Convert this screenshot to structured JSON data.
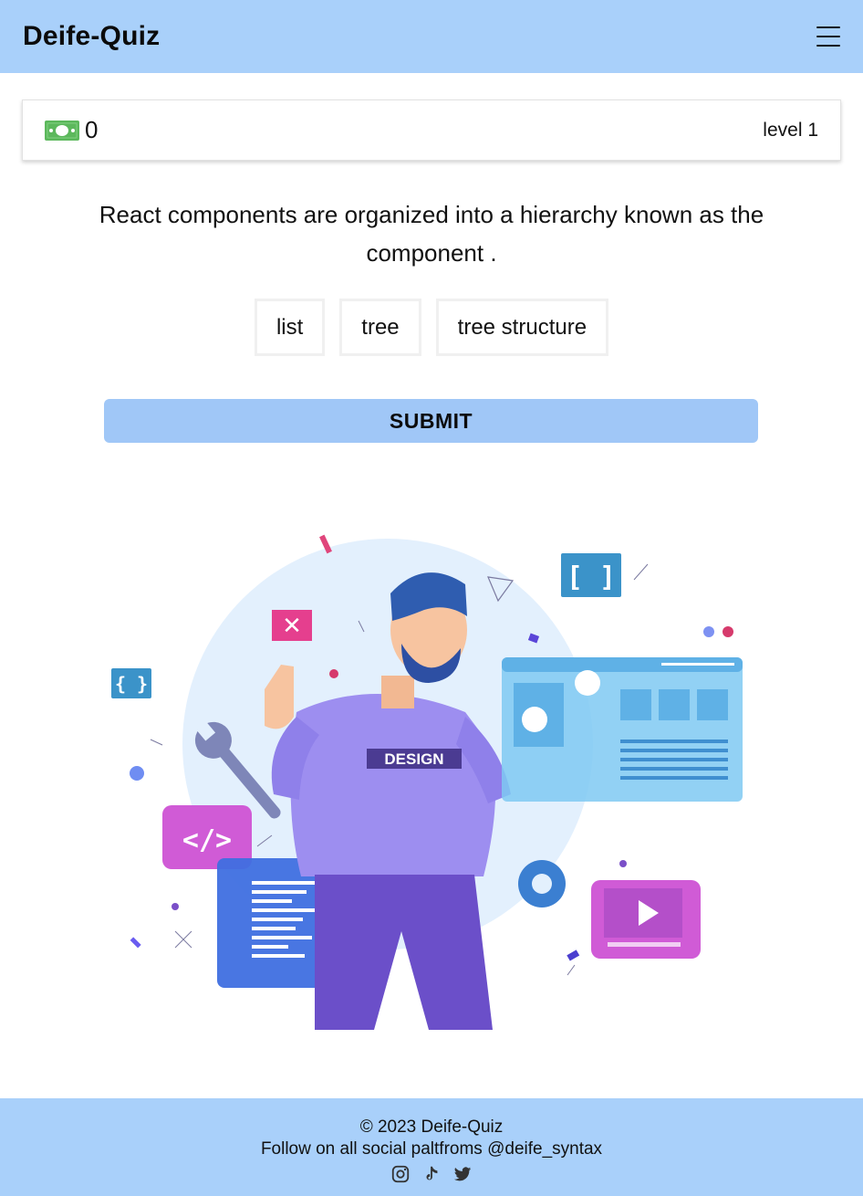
{
  "navbar": {
    "brand": "Deife-Quiz",
    "menu_icon": "hamburger-menu-icon"
  },
  "score_card": {
    "money_icon": "banknote-icon",
    "money_color": "#5cb85c",
    "score": "0",
    "level": "level 1"
  },
  "question": {
    "text": "React components are organized into a hierarchy known as the component ."
  },
  "options": [
    {
      "label": "list"
    },
    {
      "label": "tree"
    },
    {
      "label": "tree structure"
    }
  ],
  "submit": {
    "label": "SUBMIT",
    "color": "#a0c7f7"
  },
  "illustration": {
    "shirt_text": "DESIGN"
  },
  "footer": {
    "copyright": "© 2023 Deife-Quiz",
    "follow": "Follow on all social paltfroms @deife_syntax",
    "icons": [
      "instagram-icon",
      "tiktok-icon",
      "twitter-icon"
    ]
  },
  "colors": {
    "nav_bg": "#a9d0fa",
    "footer_bg": "#a9d0fa"
  }
}
